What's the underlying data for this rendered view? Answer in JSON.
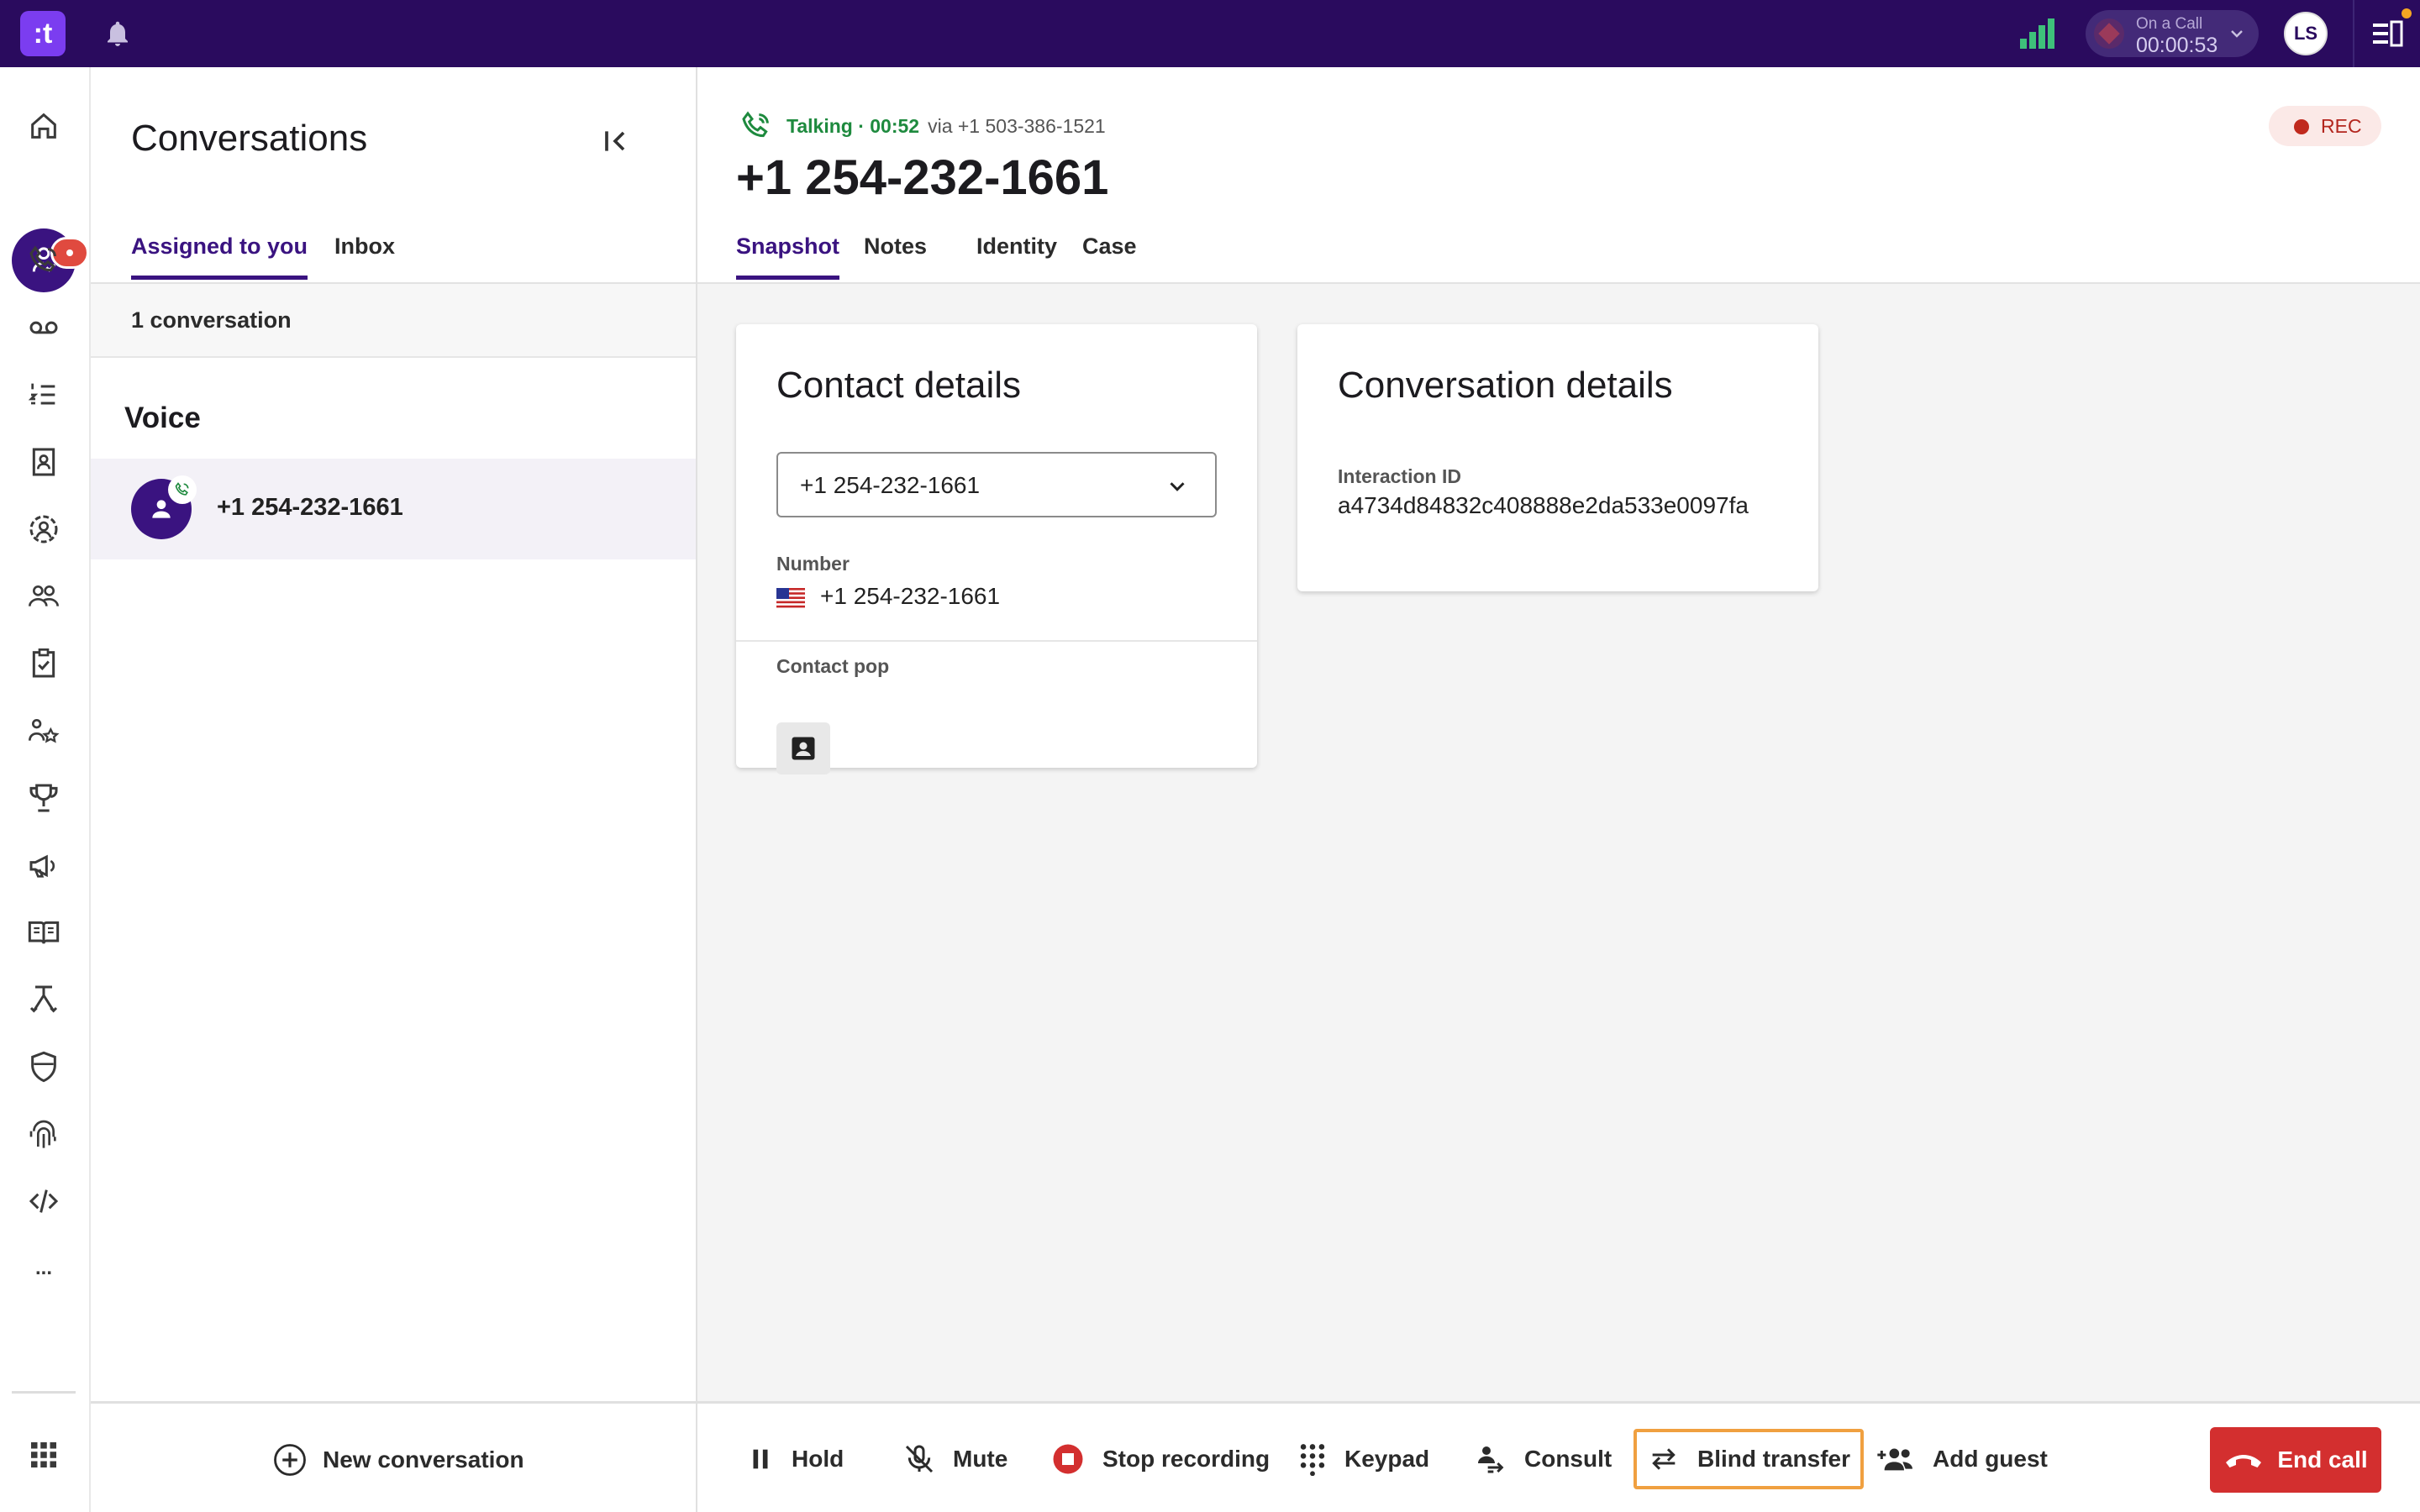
{
  "app": {
    "logo_text": ":t",
    "brand_color": "#2a0b5e",
    "accent_color": "#3a1380"
  },
  "topbar": {
    "call_status_label": "On a Call",
    "call_timer": "00:00:53",
    "user_initials": "LS"
  },
  "rail": {
    "items": [
      "home-icon",
      "conversations-icon",
      "calls-icon",
      "voicemail-icon",
      "queue-list-icon",
      "contacts-book-icon",
      "agent-icon",
      "team-icon",
      "tasks-icon",
      "skills-icon",
      "trophy-icon",
      "campaign-icon",
      "knowledge-icon",
      "routing-icon",
      "security-icon",
      "fingerprint-icon",
      "code-icon",
      "more-icon",
      "apps-grid-icon"
    ],
    "more_label": "..."
  },
  "conversations": {
    "title": "Conversations",
    "tabs": [
      {
        "label": "Assigned to you",
        "active": true
      },
      {
        "label": "Inbox",
        "active": false
      }
    ],
    "count_text": "1 conversation",
    "section_title": "Voice",
    "items": [
      {
        "number": "+1 254-232-1661"
      }
    ],
    "new_conversation_label": "New conversation"
  },
  "call": {
    "status": "Talking · 00:52",
    "via": "via +1 503-386-1521",
    "number": "+1 254-232-1661",
    "rec_label": "REC",
    "tabs": [
      {
        "label": "Snapshot",
        "active": true
      },
      {
        "label": "Notes",
        "active": false
      },
      {
        "label": "Identity",
        "active": false
      },
      {
        "label": "Case",
        "active": false
      }
    ]
  },
  "contact_details": {
    "title": "Contact details",
    "selected_number": "+1 254-232-1661",
    "number_label": "Number",
    "number_value": "+1 254-232-1661",
    "contact_pop_label": "Contact pop"
  },
  "conversation_details": {
    "title": "Conversation details",
    "interaction_id_label": "Interaction ID",
    "interaction_id": "a4734d84832c408888e2da533e0097fa"
  },
  "callbar": {
    "hold": "Hold",
    "mute": "Mute",
    "stop_recording": "Stop recording",
    "keypad": "Keypad",
    "consult": "Consult",
    "blind_transfer": "Blind transfer",
    "add_guest": "Add guest",
    "end_call": "End call"
  }
}
